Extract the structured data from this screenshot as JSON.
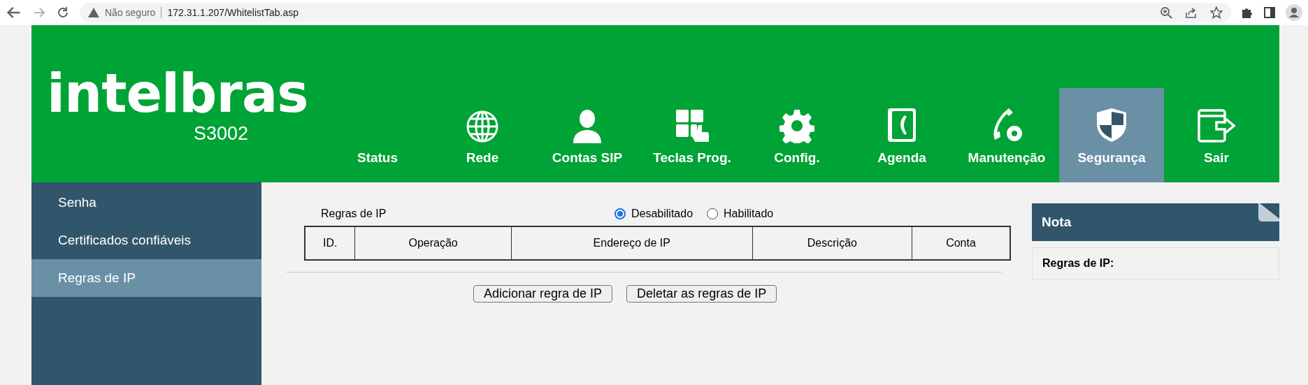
{
  "browser": {
    "security": "Não seguro",
    "url": "172.31.1.207/WhitelistTab.asp"
  },
  "header": {
    "logo": "intelbras",
    "model": "S3002",
    "nav": [
      {
        "label": "Status",
        "selected": false
      },
      {
        "label": "Rede",
        "selected": false
      },
      {
        "label": "Contas SIP",
        "selected": false
      },
      {
        "label": "Teclas Prog.",
        "selected": false
      },
      {
        "label": "Config.",
        "selected": false
      },
      {
        "label": "Agenda",
        "selected": false
      },
      {
        "label": "Manutenção",
        "selected": false
      },
      {
        "label": "Segurança",
        "selected": true
      },
      {
        "label": "Sair",
        "selected": false
      }
    ]
  },
  "sidebar": {
    "items": [
      {
        "label": "Senha",
        "selected": false
      },
      {
        "label": "Certificados confiáveis",
        "selected": false
      },
      {
        "label": "Regras de IP",
        "selected": true
      }
    ]
  },
  "rules": {
    "label": "Regras de IP",
    "options": [
      {
        "label": "Desabilitado",
        "selected": true
      },
      {
        "label": "Habilitado",
        "selected": false
      }
    ]
  },
  "table": {
    "columns": [
      "ID.",
      "Operação",
      "Endereço de IP",
      "Descrição",
      "Conta"
    ]
  },
  "buttons": [
    "Adicionar regra de IP",
    "Deletar as regras de IP"
  ],
  "note": {
    "title": "Nota",
    "body": "Regras de IP:"
  }
}
